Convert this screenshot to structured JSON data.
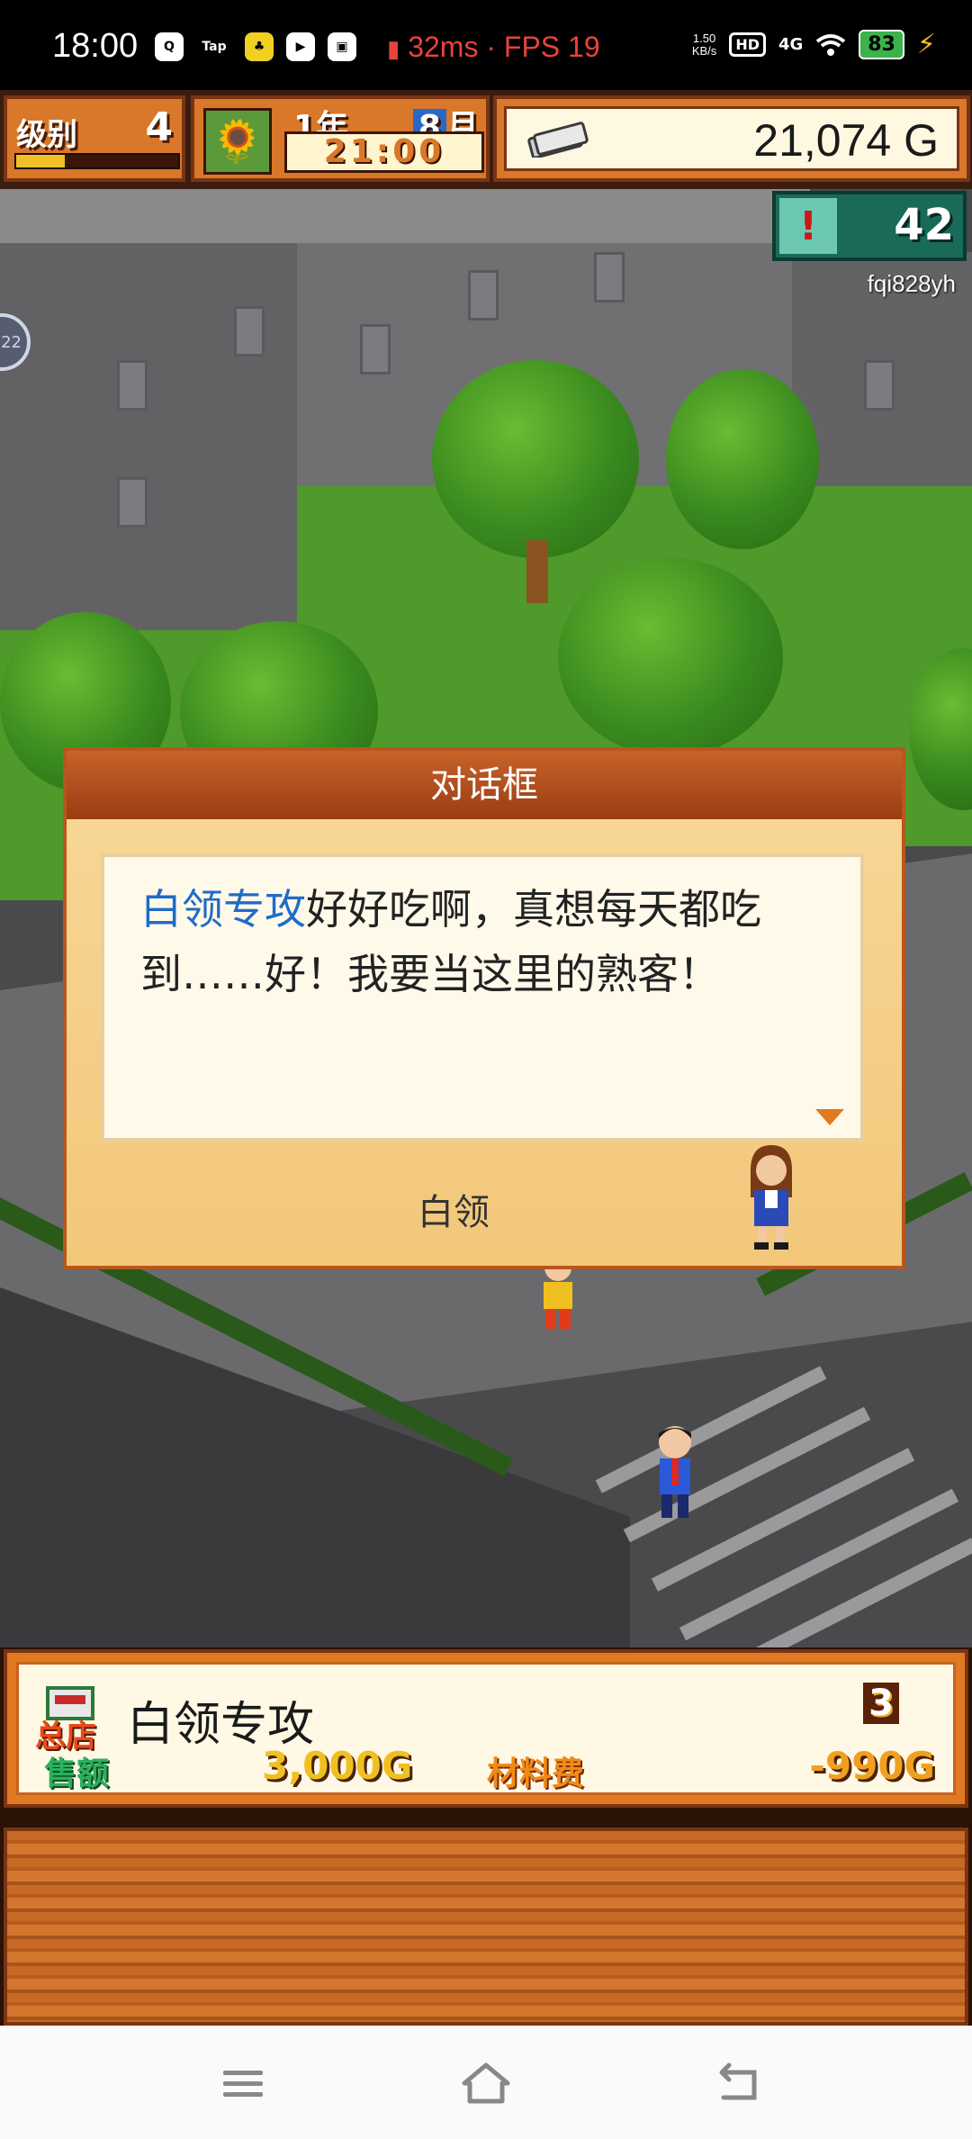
{
  "status_bar": {
    "time": "18:00",
    "apps": [
      "Q",
      "Tap",
      "♣",
      "▶",
      "▣"
    ],
    "latency_fps": "32ms · FPS 19",
    "net_speed_value": "1.50",
    "net_speed_unit": "KB/s",
    "hd": "HD",
    "network": "4G",
    "battery": "83"
  },
  "hud": {
    "level_label": "级别",
    "level_value": "4",
    "level_progress": 0.3,
    "year": "1年",
    "month_num": "8",
    "month_unit": "月",
    "clock": "21:00",
    "money": "21,074 G",
    "alert_count": "42",
    "username": "fqi828yh",
    "side_badge": "22"
  },
  "dialog": {
    "title": "对话框",
    "message_name": "白领专攻",
    "message_text": "好好吃啊，真想每天都吃到……好！我要当这里的熟客！",
    "speaker": "白领"
  },
  "shop": {
    "tag_label": "总店",
    "name": "白领专攻",
    "rank": "3",
    "sales_label": "售额",
    "sales_value": "3,000G",
    "cost_label": "材料费",
    "cost_value": "-990G"
  },
  "colors": {
    "hud_orange": "#d9782a",
    "dialog_header": "#9a3d12",
    "highlight_blue": "#1e6cc8",
    "grass": "#4f9a2a"
  },
  "icons": {
    "money": "money-bills-icon",
    "alert": "exclamation-alert-icon",
    "calendar": "sunflower-icon",
    "nav_menu": "menu-icon",
    "nav_home": "home-icon",
    "nav_back": "back-icon"
  }
}
